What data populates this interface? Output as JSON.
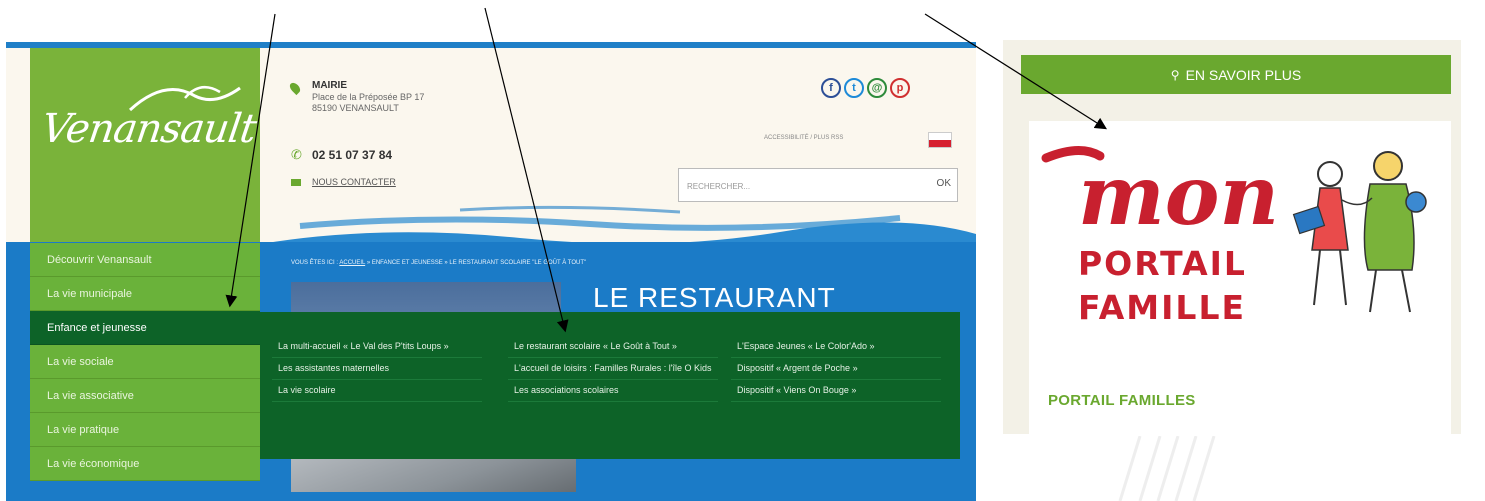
{
  "header": {
    "logo_text": "Venansault",
    "mairie_title": "MAIRIE",
    "address_line1": "Place de la Préposée BP 17",
    "address_line2": "85190 VENANSAULT",
    "phone": "02 51 07 37 84",
    "contact_link": "NOUS CONTACTER",
    "accessibility_link": "ACCESSIBILITÉ / PLUS RSS",
    "search_placeholder": "RECHERCHER...",
    "search_button": "OK",
    "social": [
      "facebook-icon",
      "twitter-icon",
      "mail-icon",
      "pinterest-icon"
    ]
  },
  "breadcrumb": {
    "prefix": "VOUS ÊTES ICI :",
    "home": "ACCUEIL",
    "path": "» ENFANCE ET JEUNESSE » LE RESTAURANT SCOLAIRE \"LE GOÛT À TOUT\""
  },
  "page_title": "LE RESTAURANT",
  "nav": {
    "items": [
      "Découvrir Venansault",
      "La vie municipale",
      "Enfance et jeunesse",
      "La vie sociale",
      "La vie associative",
      "La vie pratique",
      "La vie économique"
    ],
    "active_index": 2
  },
  "dropdown": {
    "col1": [
      "La multi-accueil « Le Val des P'tits Loups »",
      "Les assistantes maternelles",
      "La vie scolaire"
    ],
    "col2": [
      "Le restaurant scolaire « Le Goût à Tout »",
      "L'accueil de loisirs : Familles Rurales : l'île O Kids",
      "Les associations scolaires"
    ],
    "col3": [
      "L'Espace Jeunes « Le Color'Ado »",
      "Dispositif « Argent de Poche »",
      "Dispositif « Viens On Bouge »"
    ]
  },
  "sidebar_right": {
    "button": "EN SAVOIR PLUS",
    "logo_word1": "mon",
    "logo_word2": "PORTAIL",
    "logo_word3": "FAMILLE",
    "link": "PORTAIL FAMILLES"
  },
  "colors": {
    "green": "#6aa82f",
    "dark_green": "#0d6328",
    "blue": "#1b7bc7",
    "red": "#c8202f"
  }
}
